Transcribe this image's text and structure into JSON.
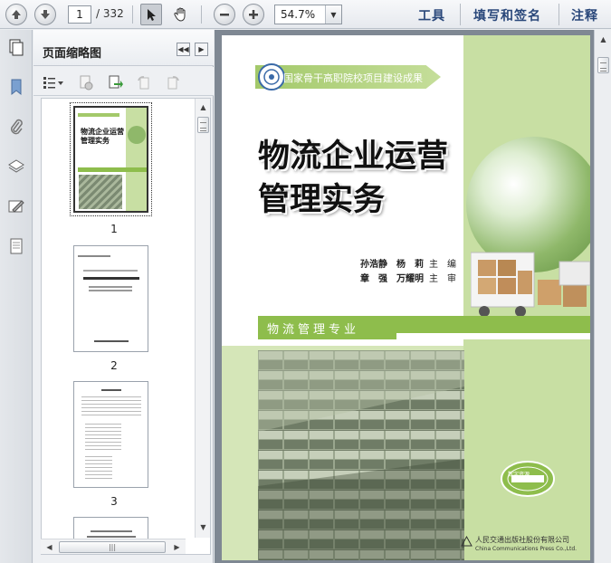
{
  "toolbar": {
    "page_current": "1",
    "page_total": "/ 332",
    "zoom_value": "54.7%",
    "menu": [
      "工具",
      "填写和签名",
      "注释"
    ]
  },
  "panel": {
    "title": "页面缩略图",
    "thumbnails": [
      {
        "page": "1"
      },
      {
        "page": "2"
      },
      {
        "page": "3"
      }
    ]
  },
  "cover": {
    "series": "国家骨干高职院校项目建设成果",
    "title_line1": "物流企业运营",
    "title_line2": "管理实务",
    "author1": "孙浩静　杨　莉",
    "author1_role": "主　编",
    "author2": "章　强　万耀明",
    "author2_role": "主　审",
    "major": "物流管理专业",
    "badge_text": "数字资源",
    "publisher_cn": "人民交通出版社股份有限公司",
    "publisher_en": "China Communications Press Co.,Ltd."
  },
  "colors": {
    "accent_green": "#8ebd4c",
    "light_green": "#c8dfa3",
    "menu_blue": "#29477a"
  }
}
